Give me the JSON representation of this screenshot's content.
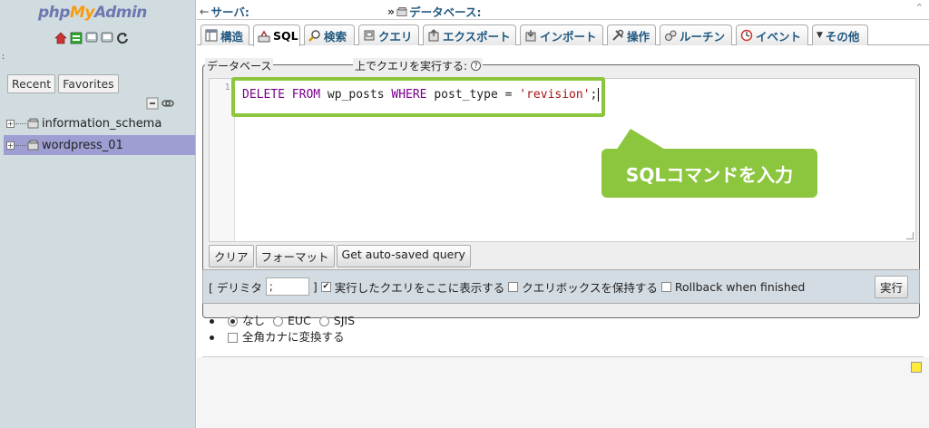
{
  "app": {
    "logo_php": "php",
    "logo_my": "My",
    "logo_admin": "Admin"
  },
  "nav": {
    "recent_label": "Recent",
    "favorites_label": "Favorites",
    "dot": ":"
  },
  "tree": [
    {
      "label": "information_schema",
      "selected": false
    },
    {
      "label": "wordpress_01",
      "selected": true
    }
  ],
  "breadcrumb": {
    "server": "サーバ:",
    "database": "データベース:"
  },
  "tabs": [
    {
      "label": "構造",
      "icon": "structure-icon"
    },
    {
      "label": "SQL",
      "icon": "sql-icon"
    },
    {
      "label": "検索",
      "icon": "search-icon"
    },
    {
      "label": "クエリ",
      "icon": "query-icon"
    },
    {
      "label": "エクスポート",
      "icon": "export-icon"
    },
    {
      "label": "インポート",
      "icon": "import-icon"
    },
    {
      "label": "操作",
      "icon": "operations-icon"
    },
    {
      "label": "ルーチン",
      "icon": "routines-icon"
    },
    {
      "label": "イベント",
      "icon": "events-icon"
    },
    {
      "label": "その他",
      "icon": "more-icon"
    }
  ],
  "sql_panel": {
    "legend_db": "データベース",
    "legend_run": "上でクエリを実行する:",
    "line_number": "1",
    "query_kw1": "DELETE FROM",
    "query_table": " wp_posts ",
    "query_kw2": "WHERE",
    "query_field": " post_type = ",
    "query_str": "'revision'",
    "query_end": ";",
    "callout": "SQLコマンドを入力",
    "btn_clear": "クリア",
    "btn_format": "フォーマット",
    "btn_autosaved": "Get auto-saved query"
  },
  "options": {
    "delimiter_label_open": "[ デリミタ",
    "delimiter_value": ";",
    "delimiter_label_close": "]",
    "show_query_label": "実行したクエリをここに表示する",
    "keep_box_label": "クエリボックスを保持する",
    "rollback_label": "Rollback when finished",
    "execute_label": "実行"
  },
  "encoding": {
    "none": "なし",
    "euc": "EUC",
    "sjis": "SJIS",
    "kana_label": "全角カナに変換する"
  },
  "colors": {
    "accent": "#8cc63f",
    "nav_bg": "#d0dce0",
    "selected_row": "#9e9ed3",
    "link": "#235a81"
  }
}
